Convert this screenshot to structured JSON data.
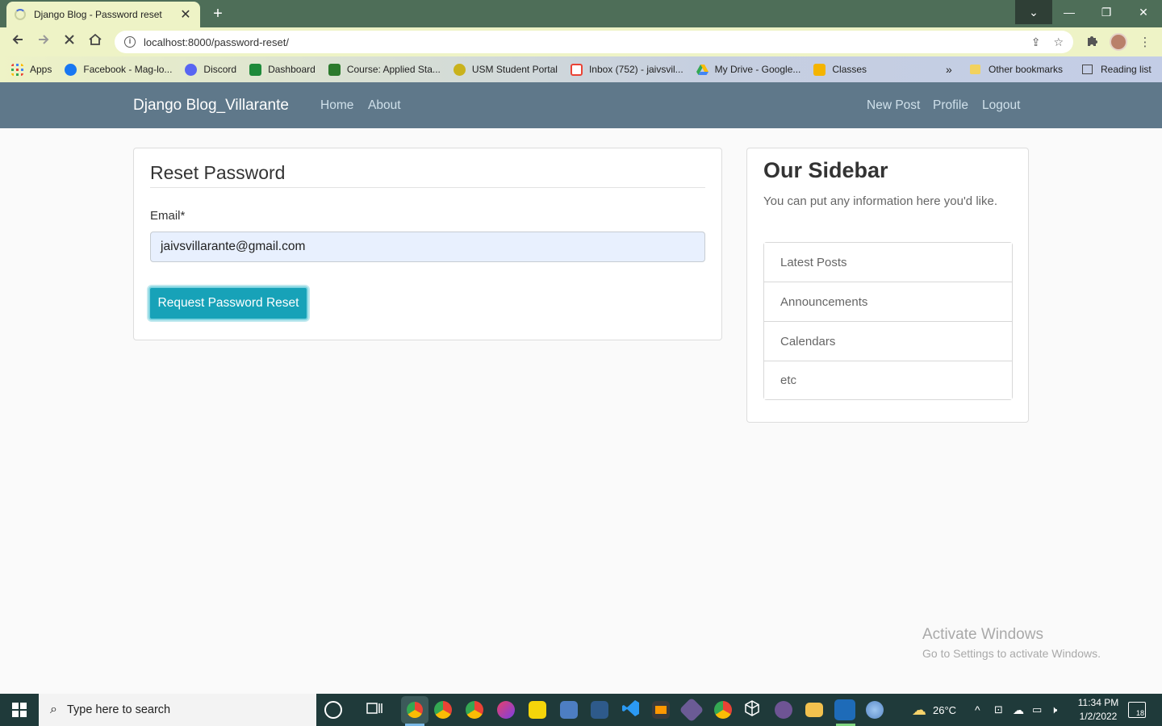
{
  "browser": {
    "tab_title": "Django Blog - Password reset",
    "tab_close": "✕",
    "new_tab": "+",
    "url": "localhost:8000/password-reset/",
    "window_controls": {
      "dropdown": "⌄",
      "minimize": "—",
      "restore": "❐",
      "close": "✕"
    }
  },
  "bookmarks": {
    "items": [
      {
        "label": "Apps",
        "color": "#e94235"
      },
      {
        "label": "Facebook - Mag-lo...",
        "color": "#1877f2"
      },
      {
        "label": "Discord",
        "color": "#5865f2"
      },
      {
        "label": "Dashboard",
        "color": "#1e8a3a"
      },
      {
        "label": "Course: Applied Sta...",
        "color": "#2c7a2c"
      },
      {
        "label": "USM Student Portal",
        "color": "#c9b21c"
      },
      {
        "label": "Inbox (752) - jaivsvil...",
        "color": "#ea4335"
      },
      {
        "label": "My Drive - Google...",
        "color": "#34a853"
      },
      {
        "label": "Classes",
        "color": "#f4b400"
      }
    ],
    "overflow": "»",
    "other": "Other bookmarks",
    "reading_list": "Reading list"
  },
  "site": {
    "brand": "Django Blog_Villarante",
    "nav_left": [
      "Home",
      "About"
    ],
    "nav_right": [
      "New Post",
      "Profile",
      "Logout"
    ]
  },
  "form": {
    "legend": "Reset Password",
    "email_label": "Email*",
    "email_value": "jaivsvillarante@gmail.com",
    "submit_label": "Request Password Reset"
  },
  "sidebar": {
    "title": "Our Sidebar",
    "text": "You can put any information here you'd like.",
    "items": [
      "Latest Posts",
      "Announcements",
      "Calendars",
      "etc"
    ]
  },
  "watermark": {
    "line1": "Activate Windows",
    "line2": "Go to Settings to activate Windows."
  },
  "taskbar": {
    "search_placeholder": "Type here to search",
    "weather": "26°C",
    "time": "11:34 PM",
    "date": "1/2/2022",
    "notifications": "18"
  },
  "colors": {
    "navbar": "#5f788a",
    "button": "#17a2b8",
    "chrome_frame": "#4e6e58",
    "toolbar": "#eef3c6"
  }
}
